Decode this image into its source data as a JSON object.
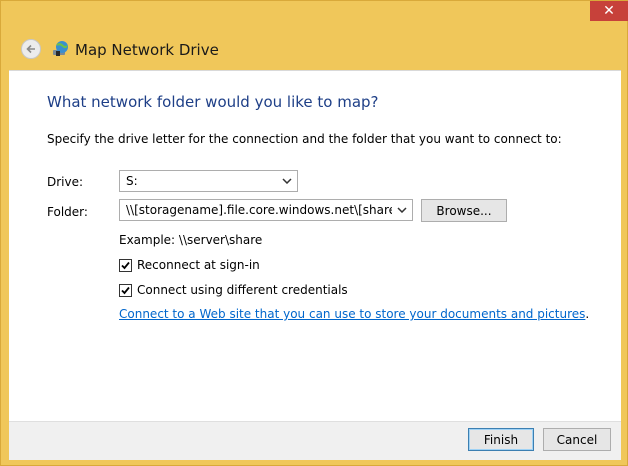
{
  "window": {
    "close_glyph": "✕"
  },
  "header": {
    "title": "Map Network Drive"
  },
  "content": {
    "heading": "What network folder would you like to map?",
    "description": "Specify the drive letter for the connection and the folder that you want to connect to:",
    "drive_label": "Drive:",
    "drive_value": "S:",
    "folder_label": "Folder:",
    "folder_value": "\\\\[storagename].file.core.windows.net\\[sharename]",
    "browse_label": "Browse...",
    "example_text": "Example: \\\\server\\share",
    "reconnect_label": "Reconnect at sign-in",
    "reconnect_checked": true,
    "credentials_label": "Connect using different credentials",
    "credentials_checked": true,
    "link_text": "Connect to a Web site that you can use to store your documents and pictures",
    "link_suffix": "."
  },
  "footer": {
    "finish_label": "Finish",
    "cancel_label": "Cancel"
  },
  "colors": {
    "window_frame": "#f0c75a",
    "heading": "#1e3f87",
    "link": "#0066cc",
    "close": "#c7413a"
  },
  "icons": {
    "back": "back-arrow-icon",
    "app": "network-drive-icon",
    "close": "close-icon",
    "dropdown": "chevron-down-icon",
    "check": "checkmark-icon"
  }
}
